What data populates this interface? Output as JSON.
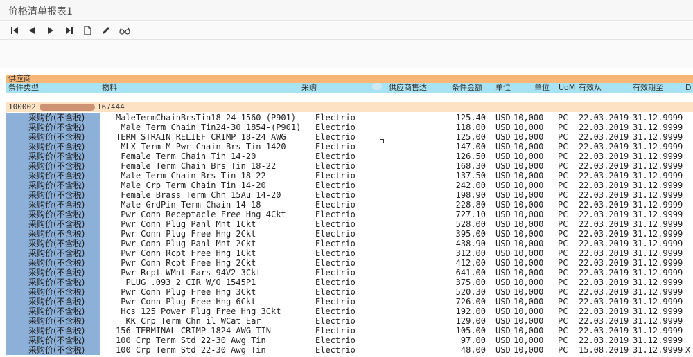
{
  "window": {
    "title": "价格清单报表1"
  },
  "toolbar": {
    "buttons": [
      {
        "name": "first-page-icon"
      },
      {
        "name": "prev-page-icon"
      },
      {
        "name": "next-page-icon"
      },
      {
        "name": "last-page-icon"
      },
      {
        "name": "document-icon"
      },
      {
        "name": "pencil-icon"
      },
      {
        "name": "glasses-icon"
      }
    ]
  },
  "report": {
    "header1": "供应商",
    "columns": {
      "condition_type": "条件类型",
      "material": "物料",
      "purchasing": "采购",
      "vendor_sales": "供应商售达",
      "amount": "条件金额",
      "currency": "单位",
      "unit": "单位",
      "uom": "UoM",
      "valid_from": "有效从",
      "valid_to": "有效期至",
      "d": "D"
    },
    "vendor": {
      "id": "100002",
      "number": "167444"
    },
    "rows": [
      {
        "type": "采购价(不含税)",
        "material": "MaleTermChainBrsTin18-24 1560-(P901)",
        "purch": "Electrio",
        "amount": "125.40",
        "cur": "USD",
        "per": "10,000",
        "uom": "PC",
        "from": "22.03.2019",
        "to": "31.12.9999",
        "x": ""
      },
      {
        "type": "采购价(不含税)",
        "material": " Male Term Chain Tin24-30 1854-(P901)",
        "purch": "Electrio",
        "amount": "118.00",
        "cur": "USD",
        "per": "10,000",
        "uom": "PC",
        "from": "22.03.2019",
        "to": "31.12.9999",
        "x": ""
      },
      {
        "type": "采购价(不含税)",
        "material": "TERM STRAIN RELIEF CRIMP 18-24 AWG",
        "purch": "Electrio",
        "amount": "125.00",
        "cur": "USD",
        "per": "10,000",
        "uom": "PC",
        "from": "22.03.2019",
        "to": "31.12.9999",
        "x": ""
      },
      {
        "type": "采购价(不含税)",
        "material": " MLX Term M Pwr Chain Brs Tin 1420",
        "purch": "Electrio",
        "amount": "147.00",
        "cur": "USD",
        "per": "10,000",
        "uom": "PC",
        "from": "22.03.2019",
        "to": "31.12.9999",
        "x": ""
      },
      {
        "type": "采购价(不含税)",
        "material": " Female Term Chain Tin 14-20",
        "purch": "Electrio",
        "amount": "126.50",
        "cur": "USD",
        "per": "10,000",
        "uom": "PC",
        "from": "22.03.2019",
        "to": "31.12.9999",
        "x": ""
      },
      {
        "type": "采购价(不含税)",
        "material": " Female Term Chain Brs Tin 18-22",
        "purch": "Electrio",
        "amount": "168.30",
        "cur": "USD",
        "per": "10,000",
        "uom": "PC",
        "from": "22.03.2019",
        "to": "31.12.9999",
        "x": ""
      },
      {
        "type": "采购价(不含税)",
        "material": " Male Term Chain Brs Tin 18-22",
        "purch": "Electrio",
        "amount": "137.50",
        "cur": "USD",
        "per": "10,000",
        "uom": "PC",
        "from": "22.03.2019",
        "to": "31.12.9999",
        "x": ""
      },
      {
        "type": "采购价(不含税)",
        "material": " Male Crp Term Chain Tin 14-20",
        "purch": "Electrio",
        "amount": "242.00",
        "cur": "USD",
        "per": "10,000",
        "uom": "PC",
        "from": "22.03.2019",
        "to": "31.12.9999",
        "x": ""
      },
      {
        "type": "采购价(不含税)",
        "material": " Female Brass Term Chn 15Au 14-20",
        "purch": "Electrio",
        "amount": "198.90",
        "cur": "USD",
        "per": "10,000",
        "uom": "PC",
        "from": "22.03.2019",
        "to": "31.12.9999",
        "x": ""
      },
      {
        "type": "采购价(不含税)",
        "material": " Male GrdPin Term Chain 14-18",
        "purch": "Electrio",
        "amount": "228.80",
        "cur": "USD",
        "per": "10,000",
        "uom": "PC",
        "from": "22.03.2019",
        "to": "31.12.9999",
        "x": ""
      },
      {
        "type": "采购价(不含税)",
        "material": " Pwr Conn Receptacle Free Hng 4Ckt",
        "purch": "Electrio",
        "amount": "727.10",
        "cur": "USD",
        "per": "10,000",
        "uom": "PC",
        "from": "22.03.2019",
        "to": "31.12.9999",
        "x": ""
      },
      {
        "type": "采购价(不含税)",
        "material": " Pwr Conn Plug Panl Mnt 1Ckt",
        "purch": "Electrio",
        "amount": "528.00",
        "cur": "USD",
        "per": "10,000",
        "uom": "PC",
        "from": "22.03.2019",
        "to": "31.12.9999",
        "x": ""
      },
      {
        "type": "采购价(不含税)",
        "material": " Pwr Conn Plug Free Hng 2Ckt",
        "purch": "Electrio",
        "amount": "395.00",
        "cur": "USD",
        "per": "10,000",
        "uom": "PC",
        "from": "22.03.2019",
        "to": "31.12.9999",
        "x": ""
      },
      {
        "type": "采购价(不含税)",
        "material": " Pwr Conn Plug Panl Mnt 2Ckt",
        "purch": "Electrio",
        "amount": "438.90",
        "cur": "USD",
        "per": "10,000",
        "uom": "PC",
        "from": "22.03.2019",
        "to": "31.12.9999",
        "x": ""
      },
      {
        "type": "采购价(不含税)",
        "material": " Pwr Conn Rcpt Free Hng 1Ckt",
        "purch": "Electrio",
        "amount": "312.00",
        "cur": "USD",
        "per": "10,000",
        "uom": "PC",
        "from": "22.03.2019",
        "to": "31.12.9999",
        "x": ""
      },
      {
        "type": "采购价(不含税)",
        "material": " Pwr Conn Rcpt Free Hng 2Ckt",
        "purch": "Electrio",
        "amount": "412.00",
        "cur": "USD",
        "per": "10,000",
        "uom": "PC",
        "from": "22.03.2019",
        "to": "31.12.9999",
        "x": ""
      },
      {
        "type": "采购价(不含税)",
        "material": " Pwr Rcpt WMnt Ears 94V2 3Ckt",
        "purch": "Electrio",
        "amount": "641.00",
        "cur": "USD",
        "per": "10,000",
        "uom": "PC",
        "from": "22.03.2019",
        "to": "31.12.9999",
        "x": ""
      },
      {
        "type": "采购价(不含税)",
        "material": "  PLUG .093 2 CIR W/O 1545P1",
        "purch": "Electrio",
        "amount": "375.00",
        "cur": "USD",
        "per": "10,000",
        "uom": "PC",
        "from": "22.03.2019",
        "to": "31.12.9999",
        "x": ""
      },
      {
        "type": "采购价(不含税)",
        "material": " Pwr Conn Plug Free Hng 3Ckt",
        "purch": "Electrio",
        "amount": "520.30",
        "cur": "USD",
        "per": "10,000",
        "uom": "PC",
        "from": "22.03.2019",
        "to": "31.12.9999",
        "x": ""
      },
      {
        "type": "采购价(不含税)",
        "material": " Pwr Conn Plug Free Hng 6Ckt",
        "purch": "Electrio",
        "amount": "726.00",
        "cur": "USD",
        "per": "10,000",
        "uom": "PC",
        "from": "22.03.2019",
        "to": "31.12.9999",
        "x": ""
      },
      {
        "type": "采购价(不含税)",
        "material": " Hcs 125 Power Plug Free Hng 3Ckt",
        "purch": "Electrio",
        "amount": "192.00",
        "cur": "USD",
        "per": "10,000",
        "uom": "PC",
        "from": "22.03.2019",
        "to": "31.12.9999",
        "x": ""
      },
      {
        "type": "采购价(不含税)",
        "material": "  KK Crp Term Chn il WCat Ear",
        "purch": "Electrio",
        "amount": "129.00",
        "cur": "USD",
        "per": "10,000",
        "uom": "PC",
        "from": "22.03.2019",
        "to": "31.12.9999",
        "x": ""
      },
      {
        "type": "采购价(不含税)",
        "material": "156 TERMINAL CRIMP 1824 AWG TIN",
        "purch": "Electrio",
        "amount": "105.00",
        "cur": "USD",
        "per": "10,000",
        "uom": "PC",
        "from": "22.03.2019",
        "to": "31.12.9999",
        "x": ""
      },
      {
        "type": "采购价(不含税)",
        "material": "100 Crp Term Std 22-30 Awg Tin",
        "purch": "Electrio",
        "amount": "97.00",
        "cur": "USD",
        "per": "10,000",
        "uom": "PC",
        "from": "22.03.2019",
        "to": "31.12.9999",
        "x": ""
      },
      {
        "type": "采购价(不含税)",
        "material": "100 Crp Term Std 22-30 Awg Tin",
        "purch": "Electrio",
        "amount": "48.00",
        "cur": "USD",
        "per": "10,000",
        "uom": "PC",
        "from": "15.08.2019",
        "to": "31.12.9999",
        "x": "X"
      }
    ]
  },
  "colors": {
    "header_orange": "#f8b776",
    "header_cyan": "#a7e3f2",
    "vendor_row": "#fde3c4",
    "type_cell_blue": "#8cb0d8"
  }
}
